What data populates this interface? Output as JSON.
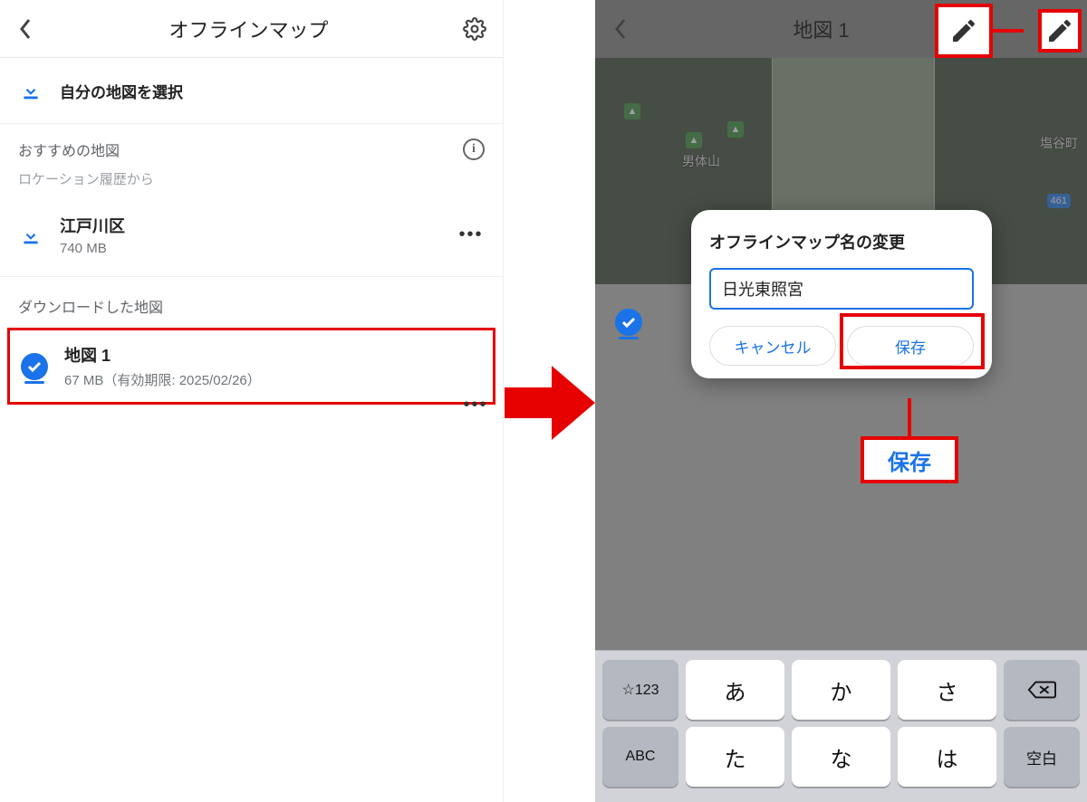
{
  "left": {
    "title": "オフラインマップ",
    "select_map_label": "自分の地図を選択",
    "recommended_label": "おすすめの地図",
    "recommended_sub": "ロケーション履歴から",
    "recommended_item": {
      "title": "江戸川区",
      "size": "740 MB"
    },
    "downloaded_label": "ダウンロードした地図",
    "downloaded_item": {
      "title": "地図 1",
      "detail": "67 MB（有効期限: 2025/02/26）"
    }
  },
  "right": {
    "title": "地図 1",
    "map_labels": {
      "peak": "男体山",
      "town": "塩谷町",
      "route": "461"
    },
    "dialog": {
      "heading": "オフラインマップ名の変更",
      "input_value": "日光東照宮",
      "cancel": "キャンセル",
      "save": "保存"
    },
    "save_callout": "保存"
  },
  "keyboard": {
    "sym": "☆123",
    "abc": "ABC",
    "row1": [
      "あ",
      "か",
      "さ"
    ],
    "row2": [
      "た",
      "な",
      "は"
    ],
    "space": "空白"
  }
}
